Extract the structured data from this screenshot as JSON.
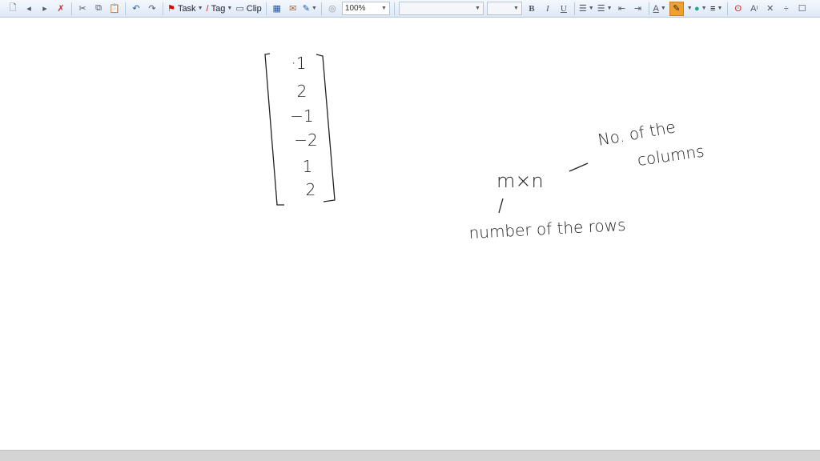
{
  "toolbar": {
    "task_label": "Task",
    "tag_label": "Tag",
    "clip_label": "Clip",
    "zoom_value": "100%",
    "font_name": "",
    "font_size": "",
    "bold": "B",
    "italic": "I",
    "underline": "U",
    "font_color": "A",
    "highlight_color": "#f0a030"
  },
  "note": {
    "matrix": [
      "·1",
      "2",
      "−1",
      "−2",
      "1",
      "2"
    ],
    "mxn": "m×n",
    "columns_line1": "No. of the",
    "columns_line2": "columns",
    "rows": "number of the rows"
  }
}
